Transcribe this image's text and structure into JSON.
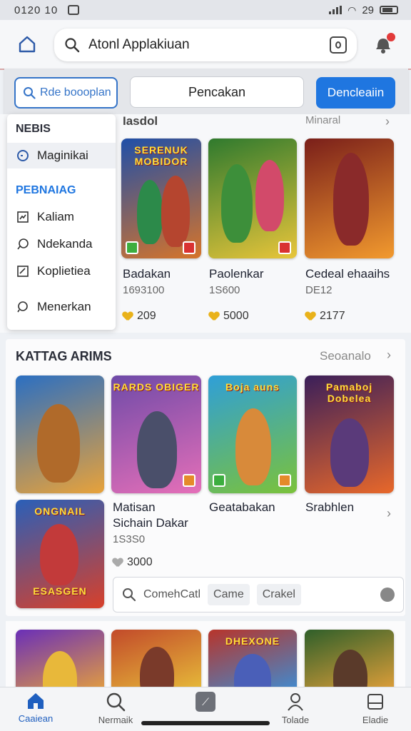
{
  "status": {
    "time": "0120 10",
    "battery": "29"
  },
  "search": {
    "text": "Atonl Applakiuan"
  },
  "filters": {
    "outline_label": "Rde boooplan",
    "middle_label": "Pencakan",
    "primary_label": "Dencleaiin"
  },
  "sidemenu": {
    "heading1": "NEBIS",
    "item_active": "Maginikai",
    "heading2": "PEBNAIAG",
    "items": [
      "Kaliam",
      "Ndekanda",
      "Koplietiea",
      "Menerkan"
    ]
  },
  "section1": {
    "label_left": "Iasdol",
    "label_right": "Minaral",
    "games": [
      {
        "caption": "SERENUK MOBIDOR",
        "title": "Badakan",
        "meta": "1693100",
        "likes": "209",
        "colors": [
          "#1f4fa8",
          "#d6742a"
        ]
      },
      {
        "caption": "",
        "title": "Paolenkar",
        "meta": "1S600",
        "likes": "5000",
        "colors": [
          "#2f7a2e",
          "#e8c53a"
        ]
      },
      {
        "caption": "",
        "title": "Cedeal ehaaihs",
        "meta": "DE12",
        "likes": "2177",
        "colors": [
          "#7a1f1a",
          "#f29a2e"
        ]
      }
    ]
  },
  "section2": {
    "heading": "KATTAG ARIMS",
    "more_label": "Seoanalo",
    "row1": [
      {
        "caption": "",
        "colors": [
          "#2b6fc2",
          "#e8a23a"
        ]
      },
      {
        "caption": "RARDS OBIGER",
        "colors": [
          "#6e4aa8",
          "#e56fb8"
        ]
      },
      {
        "caption": "Boja auns",
        "colors": [
          "#2f9fd8",
          "#7bc23a"
        ]
      },
      {
        "caption": "Pamaboj Dobelea",
        "colors": [
          "#3a1f5a",
          "#e8682a"
        ]
      }
    ],
    "row2_game": {
      "caption": "ONGNAIL",
      "bottom_caption": "ESASGEN",
      "colors": [
        "#2a5fb8",
        "#d8402a"
      ]
    },
    "row2_title_a": "Matisan",
    "row2_title_b": "Sichain Dakar",
    "row2_meta": "1S3S0",
    "row2_likes": "3000",
    "row2_title_c": "Geatabakan",
    "row2_title_d": "Srabhlen",
    "search_placeholder": "ComehCatl",
    "chip1": "Came",
    "chip2": "Crakel"
  },
  "section3": {
    "thumbs": [
      {
        "colors": [
          "#6a2fb8",
          "#e8a23a"
        ]
      },
      {
        "colors": [
          "#c24a2a",
          "#e8c03a"
        ]
      },
      {
        "caption": "DHEXONE",
        "colors": [
          "#b8342a",
          "#3a8fd8"
        ]
      },
      {
        "colors": [
          "#2f5f2a",
          "#e8a23a"
        ]
      }
    ]
  },
  "tabbar": {
    "tabs": [
      "Caaiean",
      "Nermaik",
      "",
      "Tolade",
      "Eladie"
    ]
  }
}
